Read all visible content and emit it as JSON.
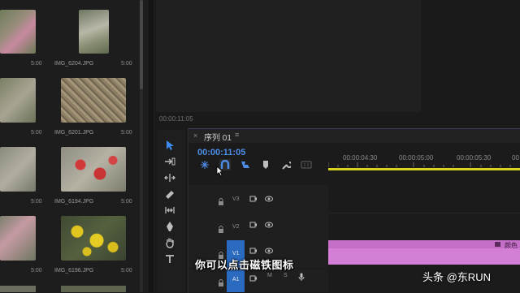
{
  "media": {
    "items": [
      {
        "name": "",
        "duration": "5:00"
      },
      {
        "name": "IMG_6204.JPG",
        "duration": "5:00"
      },
      {
        "name": "",
        "duration": "5:00"
      },
      {
        "name": "IMG_6201.JPG",
        "duration": "5:00"
      },
      {
        "name": "",
        "duration": "5:00"
      },
      {
        "name": "IMG_6194.JPG",
        "duration": "5:00"
      },
      {
        "name": "",
        "duration": "5:00"
      },
      {
        "name": "IMG_6196.JPG",
        "duration": "5:00"
      }
    ]
  },
  "monitor": {
    "timecode": "00:00:11:05"
  },
  "timeline": {
    "close": "×",
    "title": "序列 01",
    "menu": "≡",
    "timecode": "00:00:11:05",
    "ruler": [
      "00:00:04:30",
      "00:00:05:00",
      "00:00:05:30",
      "00"
    ],
    "tracks": [
      {
        "name": "V3"
      },
      {
        "name": "V2"
      },
      {
        "name": "V1"
      },
      {
        "name": "A1",
        "m": "M",
        "s": "S"
      }
    ],
    "clip_label": "颜色",
    "colors": {
      "work_bar": "#d9d21e",
      "clip": "#d37fd6",
      "target": "#2a6bc0",
      "timecode": "#4d8fe8"
    }
  },
  "subtitle": "你可以点击磁铁图标",
  "watermark": "头条 @东RUN"
}
